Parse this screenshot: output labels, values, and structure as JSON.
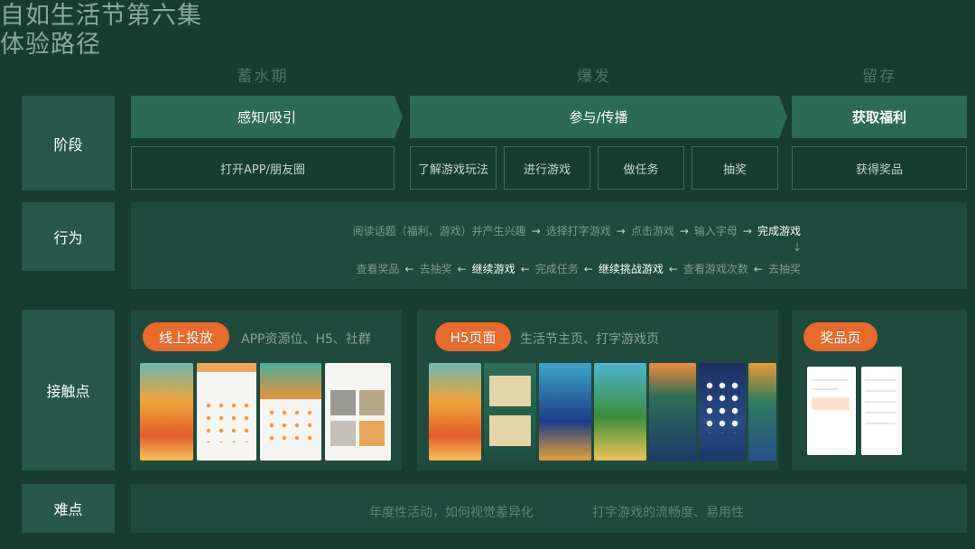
{
  "title": {
    "line1": "自如生活节第六集",
    "line2": "体验路径"
  },
  "phases": [
    "蓄水期",
    "爆发",
    "留存"
  ],
  "rows": {
    "stage": "阶段",
    "behavior": "行为",
    "touchpoint": "接触点",
    "difficulty": "难点"
  },
  "stages": [
    "感知/吸引",
    "参与/传播",
    "获取福利"
  ],
  "sub_stages": [
    "打开APP/朋友圈",
    "了解游戏玩法",
    "进行游戏",
    "做任务",
    "抽奖",
    "获得奖品"
  ],
  "flow": {
    "top": [
      "阅读话题（福利、游戏）并产生兴趣",
      "选择打字游戏",
      "点击游戏",
      "输入字母",
      "完成游戏"
    ],
    "bottom": [
      "查看奖品",
      "去抽奖",
      "继续游戏",
      "完成任务",
      "继续挑战游戏",
      "查看游戏次数",
      "去抽奖"
    ],
    "arrow_right": "→",
    "arrow_left": "←",
    "arrow_down": "↓"
  },
  "touchpoints": [
    {
      "tag": "线上投放",
      "desc": "APP资源位、H5、社群"
    },
    {
      "tag": "H5页面",
      "desc": "生活节主页、打字游戏页"
    },
    {
      "tag": "奖品页",
      "desc": ""
    }
  ],
  "difficulties": [
    "年度性活动，如何视觉差异化",
    "打字游戏的流畅度、易用性"
  ],
  "colors": {
    "background": "#183c30",
    "accent": "#e86a2c",
    "stage": "#2b6a55",
    "rowhead": "#27574a"
  }
}
